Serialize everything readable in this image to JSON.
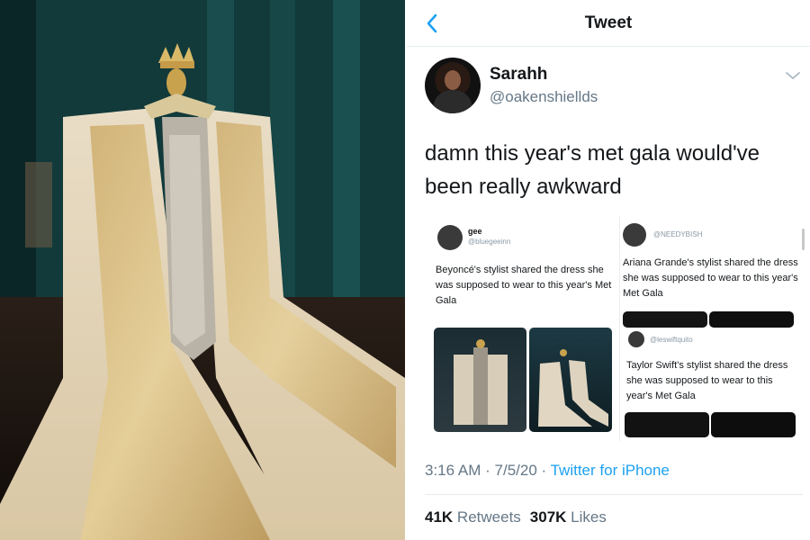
{
  "photo": {
    "description_icon": "gown-display-photo"
  },
  "nav": {
    "title": "Tweet",
    "back_icon": "chevron-left-icon"
  },
  "author": {
    "display_name": "Sarahh",
    "handle": "@oakenshiellds"
  },
  "tweet": {
    "text": "damn this year's met gala would've been really awkward",
    "embedded": {
      "left": {
        "name": "gee",
        "handle": "@bluegeeinn",
        "text": "Beyoncé's stylist shared the dress she was supposed to wear to this year's Met Gala"
      },
      "right_top": {
        "handle": "@NEEDYBISH",
        "text": "Ariana Grande's stylist shared the dress she was supposed to wear to this year's Met Gala"
      },
      "right_bottom": {
        "handle": "@leswiftquito",
        "text": "Taylor Swift's stylist shared the dress she was supposed to wear to this year's Met Gala"
      }
    }
  },
  "meta": {
    "time": "3:16 AM",
    "separator": "·",
    "date": "7/5/20",
    "source": "Twitter for iPhone"
  },
  "stats": {
    "retweets_count": "41K",
    "retweets_label": "Retweets",
    "likes_count": "307K",
    "likes_label": "Likes"
  },
  "colors": {
    "accent": "#1da1f2",
    "text": "#14171a",
    "muted": "#657786"
  }
}
